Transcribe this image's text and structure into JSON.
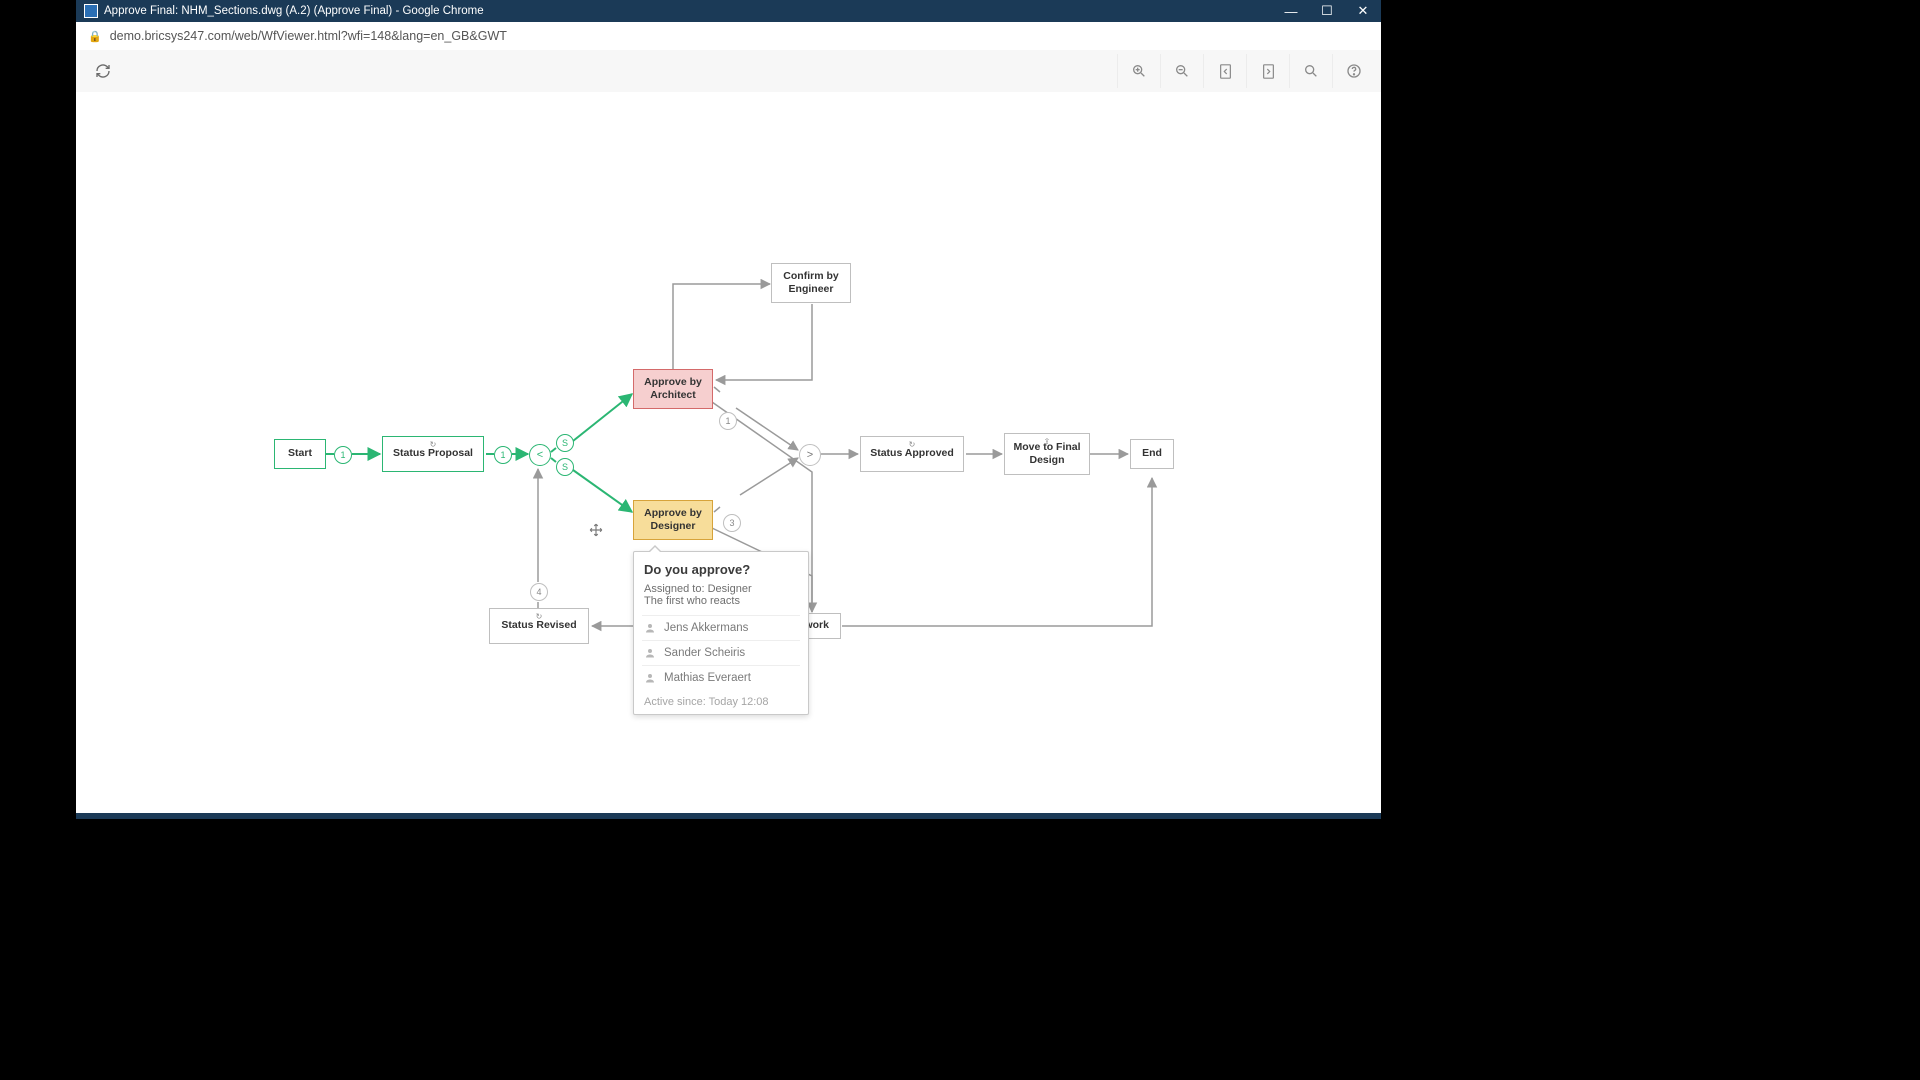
{
  "window": {
    "title": "Approve Final: NHM_Sections.dwg (A.2) (Approve Final) - Google Chrome",
    "url": "demo.bricsys247.com/web/WfViewer.html?wfi=148&lang=en_GB&GWT"
  },
  "toolbar": {
    "icons": [
      "zoom-in",
      "zoom-out",
      "page-prev",
      "page-next",
      "search",
      "help"
    ]
  },
  "nodes": {
    "start": "Start",
    "status_proposal": "Status Proposal",
    "approve_architect": "Approve by Architect",
    "approve_designer": "Approve by Designer",
    "confirm_engineer": "Confirm by Engineer",
    "status_approved": "Status Approved",
    "move_final": "Move to Final Design",
    "end": "End",
    "rework": "Rework",
    "status_revised": "Status Revised"
  },
  "badges": {
    "b1": "1",
    "b2": "1",
    "b_s1": "S",
    "b_s2": "S",
    "b3": "1",
    "b4": "3",
    "b5": "4"
  },
  "gates": {
    "split": "<",
    "join": ">"
  },
  "popover": {
    "title": "Do you approve?",
    "assigned": "Assigned to: Designer",
    "rule": "The first who reacts",
    "people": [
      "Jens Akkermans",
      "Sander Scheiris",
      "Mathias Everaert"
    ],
    "since": "Active since: Today 12:08"
  }
}
